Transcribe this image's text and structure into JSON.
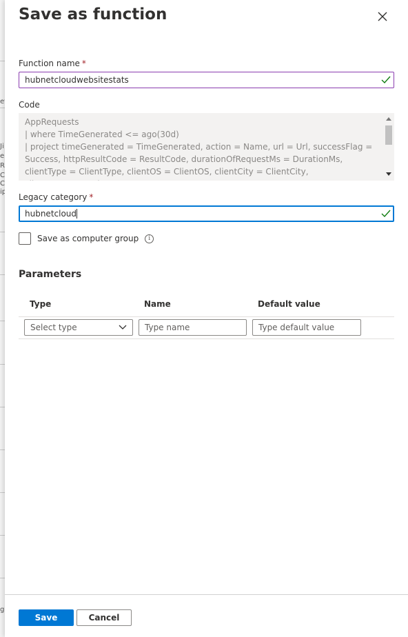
{
  "background": {
    "fragments": [
      "ev",
      "Ji",
      "er",
      "Re",
      "Co",
      "Ci",
      "ip",
      "g"
    ]
  },
  "panel": {
    "title": "Save as function",
    "function_name": {
      "label": "Function name",
      "required_mark": "*",
      "value": "hubnetcloudwebsitestats"
    },
    "code": {
      "label": "Code",
      "text": "AppRequests\n| where TimeGenerated <= ago(30d)\n| project timeGenerated = TimeGenerated, action = Name, url = Url, successFlag = Success, httpResultCode = ResultCode, durationOfRequestMs = DurationMs, clientType = ClientType, clientOS = ClientOS, clientCity = ClientCity, clientStateOrProvince ="
    },
    "legacy_category": {
      "label": "Legacy category",
      "required_mark": "*",
      "value": "hubnetcloud"
    },
    "computer_group": {
      "label": "Save as computer group",
      "checked": false,
      "info_icon": "info-icon"
    },
    "parameters": {
      "title": "Parameters",
      "columns": [
        "Type",
        "Name",
        "Default value"
      ],
      "row": {
        "type_placeholder": "Select type",
        "name_placeholder": "Type name",
        "default_placeholder": "Type default value"
      }
    },
    "footer": {
      "save_label": "Save",
      "cancel_label": "Cancel"
    }
  },
  "colors": {
    "accent": "#0078d4",
    "required": "#a4262c",
    "valid_check": "#107c10",
    "focused_border_purple": "#8a3caf"
  }
}
